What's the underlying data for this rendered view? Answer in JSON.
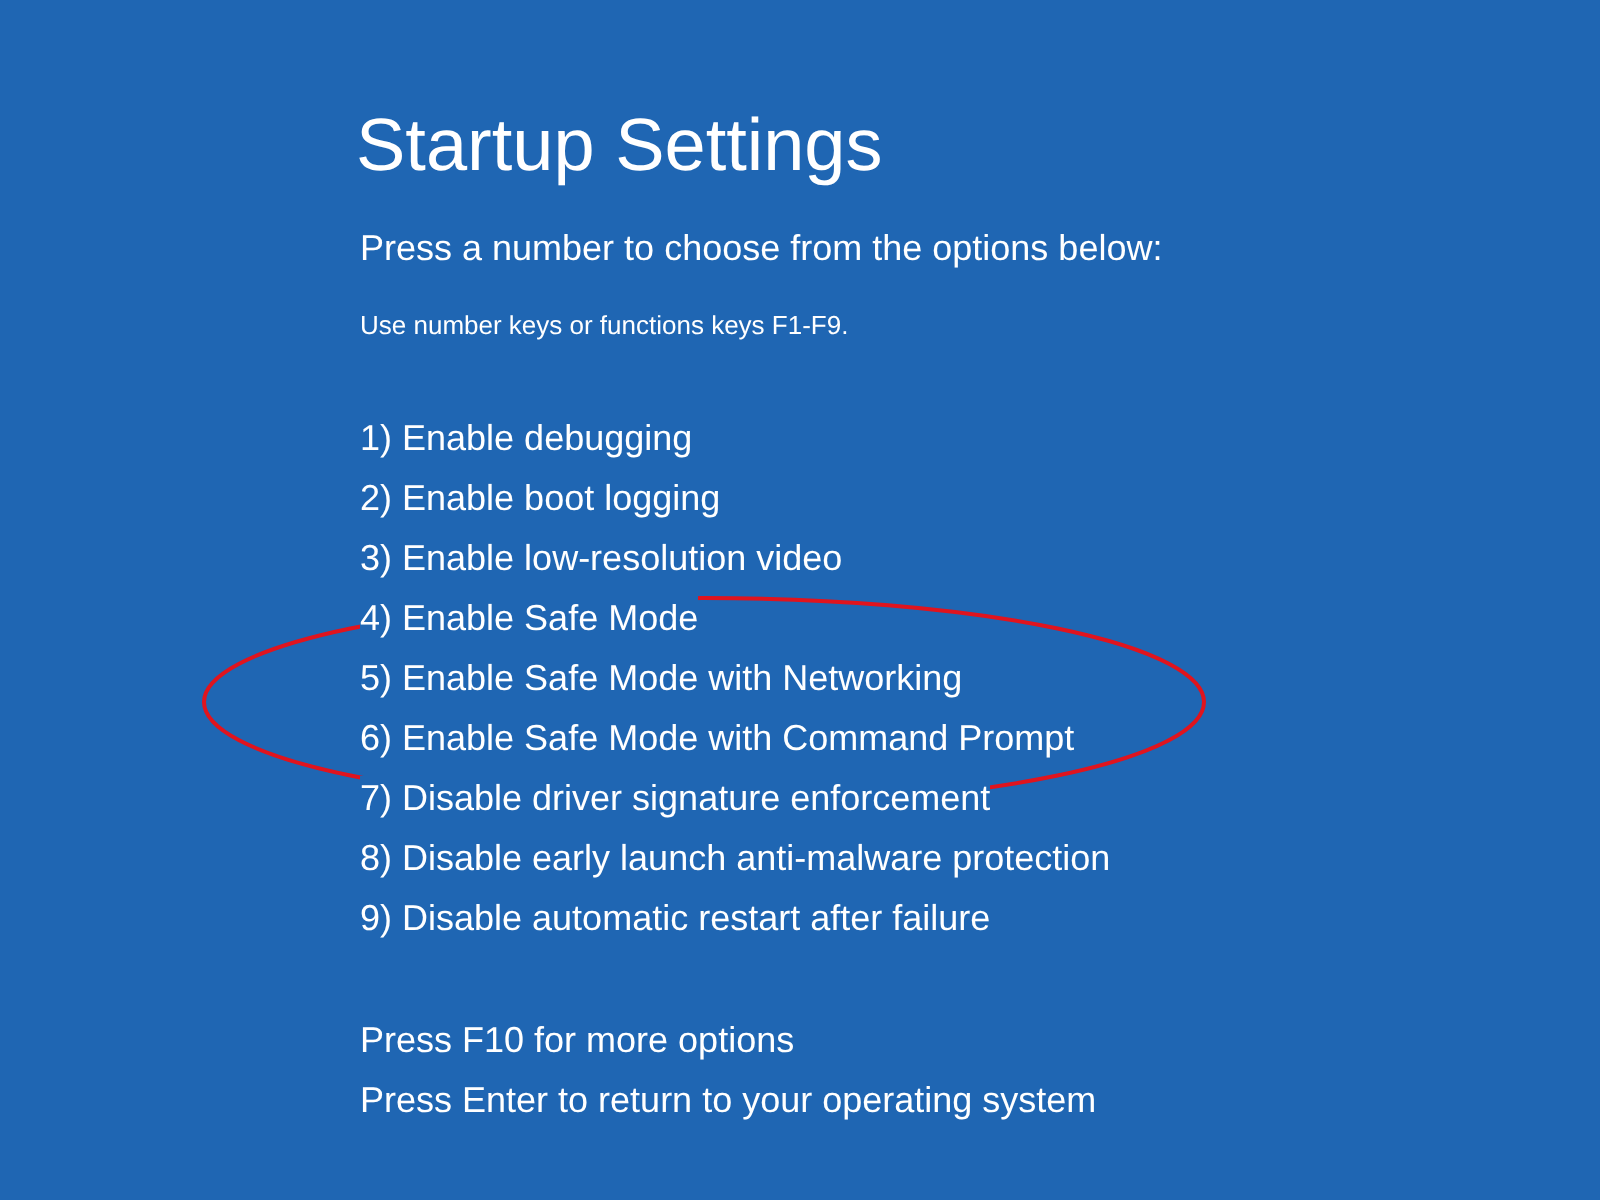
{
  "title": "Startup Settings",
  "prompt": "Press a number to choose from the options below:",
  "hint": "Use number keys or functions keys F1-F9.",
  "options": [
    "1) Enable debugging",
    "2) Enable boot logging",
    "3) Enable low-resolution video",
    "4) Enable Safe Mode",
    "5) Enable Safe Mode with Networking",
    "6) Enable Safe Mode with Command Prompt",
    "7) Disable driver signature enforcement",
    "8) Disable early launch anti-malware protection",
    "9) Disable automatic restart after failure"
  ],
  "footer": [
    "Press F10 for more options",
    "Press Enter to return to your operating system"
  ]
}
